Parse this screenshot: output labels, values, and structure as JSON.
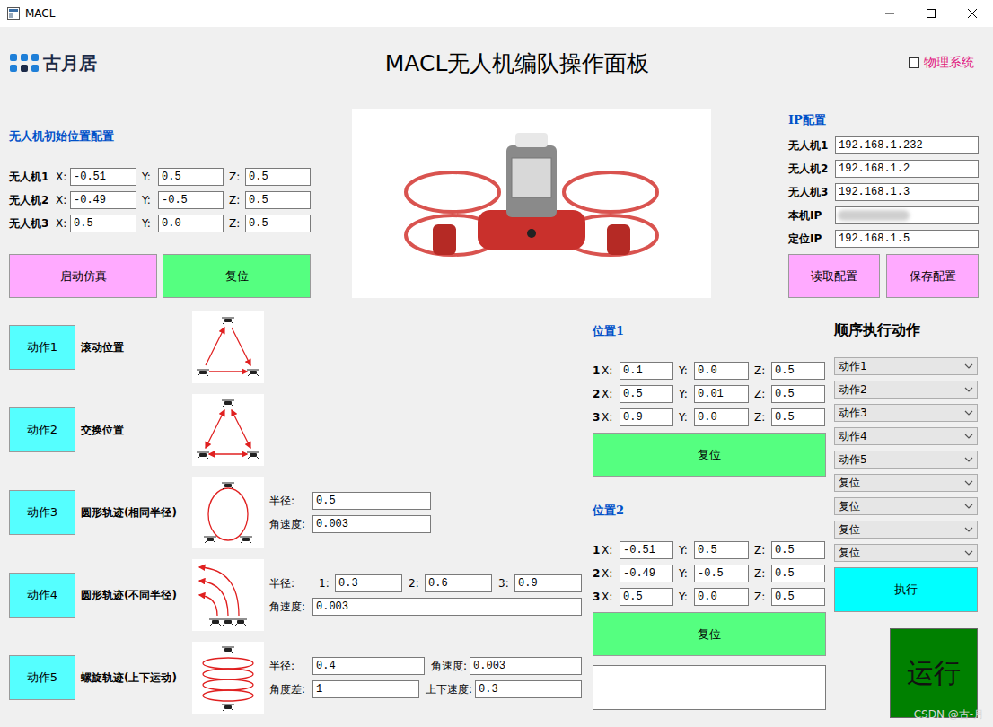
{
  "window": {
    "title": "MACL"
  },
  "header": {
    "logo_text": "古月居",
    "title": "MACL无人机编队操作面板",
    "physics": {
      "label": "物理系统",
      "checked": false
    }
  },
  "init_config": {
    "title": "无人机初始位置配置",
    "axis_labels": [
      "X:",
      "Y:",
      "Z:"
    ],
    "rows": [
      {
        "label": "无人机1",
        "x": "-0.51",
        "y": "0.5",
        "z": "0.5"
      },
      {
        "label": "无人机2",
        "x": "-0.49",
        "y": "-0.5",
        "z": "0.5"
      },
      {
        "label": "无人机3",
        "x": "0.5",
        "y": "0.0",
        "z": "0.5"
      }
    ]
  },
  "sim_buttons": [
    {
      "label": "启动仿真",
      "color": "#ffaaff"
    },
    {
      "label": "复位",
      "color": "#55ff80"
    }
  ],
  "ip": {
    "title": "IP配置",
    "rows": [
      {
        "label": "无人机1",
        "value": "192.168.1.232",
        "masked": false
      },
      {
        "label": "无人机2",
        "value": "192.168.1.2",
        "masked": false
      },
      {
        "label": "无人机3",
        "value": "192.168.1.3",
        "masked": false
      },
      {
        "label": "本机IP",
        "value": "",
        "masked": true
      },
      {
        "label": "定位IP",
        "value": "192.168.1.5",
        "masked": false
      }
    ],
    "buttons": [
      "读取配置",
      "保存配置"
    ]
  },
  "actions": [
    {
      "button": "动作1",
      "label": "滚动位置",
      "kind": "roll",
      "params": []
    },
    {
      "button": "动作2",
      "label": "交换位置",
      "kind": "swap",
      "params": []
    },
    {
      "button": "动作3",
      "label": "圆形轨迹(相同半径)",
      "kind": "circle-same",
      "params": [
        [
          {
            "label": "半径:",
            "value": "0.5"
          }
        ],
        [
          {
            "label": "角速度:",
            "value": "0.003"
          }
        ]
      ]
    },
    {
      "button": "动作4",
      "label": "圆形轨迹(不同半径)",
      "kind": "circle-diff",
      "params": [
        [
          {
            "label": "半径:"
          },
          {
            "label": "1:",
            "value": "0.3"
          },
          {
            "label": "2:",
            "value": "0.6"
          },
          {
            "label": "3:",
            "value": "0.9"
          }
        ],
        [
          {
            "label": "角速度:",
            "value": "0.003"
          }
        ]
      ]
    },
    {
      "button": "动作5",
      "label": "螺旋轨迹(上下运动)",
      "kind": "spiral",
      "params": [
        [
          {
            "label": "半径:",
            "value": "0.4"
          },
          {
            "label": "角速度:",
            "value": "0.003"
          }
        ],
        [
          {
            "label": "角度差:",
            "value": "1"
          },
          {
            "label": "上下速度:",
            "value": "0.3"
          }
        ]
      ]
    }
  ],
  "positions": [
    {
      "title": "位置1",
      "axis_labels": [
        "X:",
        "Y:",
        "Z:"
      ],
      "rows": [
        {
          "label": "1",
          "x": "0.1",
          "y": "0.0",
          "z": "0.5"
        },
        {
          "label": "2",
          "x": "0.5",
          "y": "0.01",
          "z": "0.5"
        },
        {
          "label": "3",
          "x": "0.9",
          "y": "0.0",
          "z": "0.5"
        }
      ],
      "button": "复位"
    },
    {
      "title": "位置2",
      "axis_labels": [
        "X:",
        "Y:",
        "Z:"
      ],
      "rows": [
        {
          "label": "1",
          "x": "-0.51",
          "y": "0.5",
          "z": "0.5"
        },
        {
          "label": "2",
          "x": "-0.49",
          "y": "-0.5",
          "z": "0.5"
        },
        {
          "label": "3",
          "x": "0.5",
          "y": "0.0",
          "z": "0.5"
        }
      ],
      "button": "复位"
    }
  ],
  "output": {
    "text": ""
  },
  "sequence": {
    "title": "顺序执行动作",
    "steps": [
      "动作1",
      "动作2",
      "动作3",
      "动作4",
      "动作5",
      "复位",
      "复位",
      "复位",
      "复位"
    ],
    "execute": "执行"
  },
  "run": "运行",
  "watermark": "CSDN @古-月"
}
